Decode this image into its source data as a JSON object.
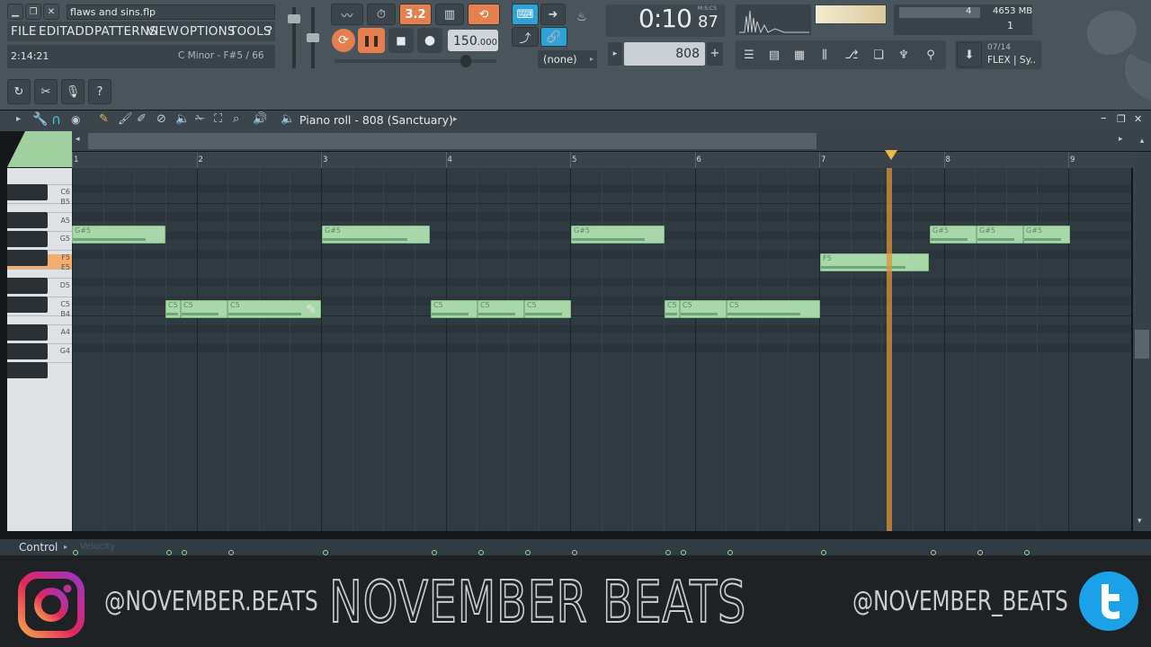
{
  "window": {
    "file_name": "flaws and sins.flp",
    "position": "2:14:21",
    "key_hint": "C Minor - F#5 / 66"
  },
  "menu": [
    "FILE",
    "EDIT",
    "ADD",
    "PATTERNS",
    "VIEW",
    "OPTIONS",
    "TOOLS",
    "?"
  ],
  "transport": {
    "tempo": "150",
    "tempo_decimals": ".000",
    "time_main": "0:10",
    "time_sub": "87",
    "time_unit": "M:S:CS",
    "snap": "(none)",
    "pattern_label": "808",
    "memory": "4653 MB",
    "cpu_count": "4",
    "voices": "1",
    "plugin_counter": "07/14",
    "plugin_name": "FLEX | Sy..",
    "metronome_label": "3.2"
  },
  "piano_roll": {
    "title": "Piano roll - 808 (Sanctuary)",
    "bar_numbers": [
      "1",
      "2",
      "3",
      "4",
      "5",
      "6",
      "7",
      "8",
      "9"
    ],
    "control_label": "Control",
    "velocity_label": "Velocity"
  },
  "keyboard_labels": [
    "C6",
    "B5",
    "A5",
    "G5",
    "F5",
    "E5",
    "D5",
    "C5",
    "B4",
    "A4",
    "G4"
  ],
  "notes": [
    {
      "label": "G#5",
      "row": "G#5"
    },
    {
      "label": "G#5",
      "row": "G#5"
    },
    {
      "label": "G#5",
      "row": "G#5"
    },
    {
      "label": "G#5",
      "row": "G#5"
    },
    {
      "label": "G#5",
      "row": "G#5"
    },
    {
      "label": "G#5",
      "row": "G#5"
    },
    {
      "label": "F5",
      "row": "F5"
    },
    {
      "label": "C5",
      "row": "C5"
    },
    {
      "label": "C5",
      "row": "C5"
    },
    {
      "label": "C5",
      "row": "C5"
    },
    {
      "label": "C5",
      "row": "C5"
    },
    {
      "label": "C5",
      "row": "C5"
    },
    {
      "label": "C5",
      "row": "C5"
    },
    {
      "label": "C5",
      "row": "C5"
    },
    {
      "label": "C5",
      "row": "C5"
    },
    {
      "label": "C5",
      "row": "C5"
    }
  ],
  "footer": {
    "instagram_handle": "@NOVEMBER.BEATS",
    "brand": "NOVEMBER BEATS",
    "twitter_handle": "@NOVEMBER_BEATS"
  },
  "colors": {
    "note_fill": "#a8d7a9",
    "playhead": "#e0913a",
    "accent_orange": "#e5804e",
    "accent_blue": "#2ea3d8",
    "grid_bg": "#2f3a41"
  }
}
